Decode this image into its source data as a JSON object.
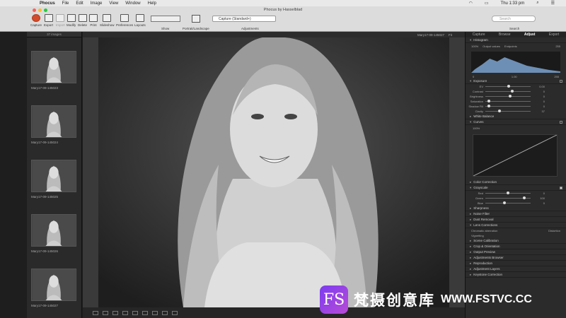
{
  "menubar": {
    "apple": "",
    "app": "Phocus",
    "items": [
      "File",
      "Edit",
      "Image",
      "View",
      "Window",
      "Help"
    ],
    "clock": "Thu 1:33 pm"
  },
  "window": {
    "title": "Phocus by Hasselblad"
  },
  "toolbar": {
    "buttons": [
      "Capture",
      "Export",
      "Import",
      "Modify",
      "Delete",
      "Print",
      "Slideshow",
      "Preferences",
      "Layouts"
    ],
    "show_label": "Show",
    "portrait_label": "Portrait/Landscape",
    "preset": "Capture (Standard+)",
    "adjustments_label": "Adjustments",
    "search_placeholder": "Search",
    "search_label": "Search"
  },
  "browser": {
    "count": "37 images",
    "thumbs": [
      "Mary17-09-145023",
      "Mary17-09-145024",
      "Mary17-09-145025",
      "Mary17-09-145026",
      "Mary17-09-145027"
    ]
  },
  "viewer": {
    "filename": "Mary17-09-145027",
    "zoom": "Fit"
  },
  "panel": {
    "tabs": [
      "Capture",
      "Browse",
      "Adjust",
      "Export"
    ],
    "histogram": {
      "title": "Histogram",
      "zoom": "100%",
      "output": "Output values",
      "endpoints": "Endpoints",
      "top": "255",
      "low": "0",
      "mid": "1.00",
      "high": "255"
    },
    "exposure": {
      "title": "Exposure",
      "sliders": [
        {
          "label": "EV",
          "value": "0.00",
          "pos": 0.52
        },
        {
          "label": "Contrast",
          "value": "0",
          "pos": 0.6
        },
        {
          "label": "Brightness",
          "value": "0",
          "pos": 0.55
        },
        {
          "label": "Saturation",
          "value": "0",
          "pos": 0.05
        },
        {
          "label": "Shadow Fill",
          "value": "0",
          "pos": 0.05
        },
        {
          "label": "Clarity",
          "value": "37",
          "pos": 0.3
        }
      ]
    },
    "sections_a": [
      "White Balance",
      "Curves"
    ],
    "curves_zoom": "100%",
    "sections_b": [
      "Color Correction",
      "Grayscale"
    ],
    "grayscale": [
      {
        "label": "Red",
        "value": "0",
        "pos": 0.5
      },
      {
        "label": "Green",
        "value": "100",
        "pos": 0.88
      },
      {
        "label": "Blue",
        "value": "0",
        "pos": 0.42
      }
    ],
    "sections_c": [
      "Sharpness",
      "Noise Filter",
      "Dust Removal",
      "Lens Corrections"
    ],
    "lens": {
      "chroma": "Chromatic aberration",
      "distortion": "Distortion",
      "vignetting": "Vignetting"
    },
    "sections_d": [
      "Scene Calibration",
      "Crop & Orientation",
      "Output Preview",
      "Adjustments Browser",
      "Reproduction",
      "Adjustment Layers",
      "Keystone Correction"
    ]
  },
  "watermark": {
    "logo": "FS",
    "cn": "梵摄创意库",
    "url": "WWW.FSTVC.CC"
  }
}
